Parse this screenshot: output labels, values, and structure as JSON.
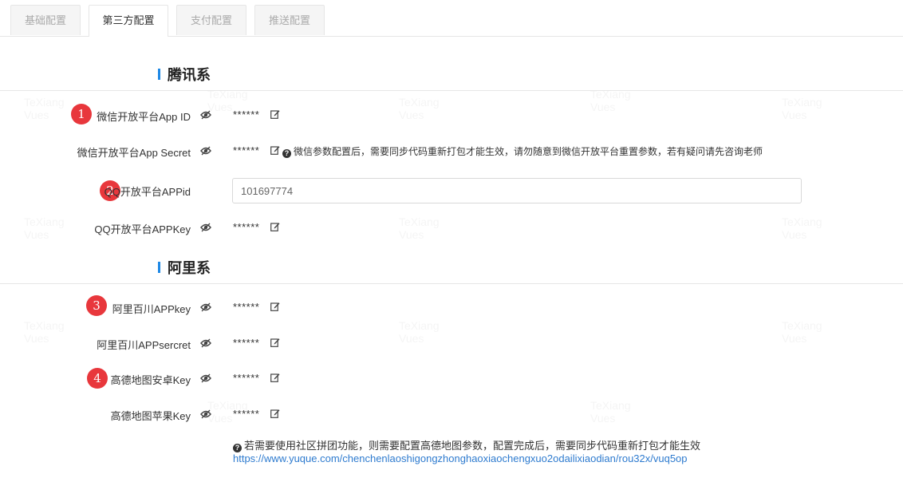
{
  "tabs": [
    {
      "label": "基础配置",
      "active": false
    },
    {
      "label": "第三方配置",
      "active": true
    },
    {
      "label": "支付配置",
      "active": false
    },
    {
      "label": "推送配置",
      "active": false
    }
  ],
  "sections": {
    "tencent": {
      "title": "腾讯系"
    },
    "ali": {
      "title": "阿里系"
    }
  },
  "fields": {
    "wechat_appid": {
      "label": "微信开放平台App ID",
      "value": "******",
      "badge": "1"
    },
    "wechat_secret": {
      "label": "微信开放平台App Secret",
      "value": "******",
      "hint": "微信参数配置后，需要同步代码重新打包才能生效，请勿随意到微信开放平台重置参数，若有疑问请先咨询老师"
    },
    "qq_appid": {
      "label": "QQ开放平台APPid",
      "value": "101697774",
      "badge": "2"
    },
    "qq_appkey": {
      "label": "QQ开放平台APPKey",
      "value": "******"
    },
    "bc_appkey": {
      "label": "阿里百川APPkey",
      "value": "******",
      "badge": "3"
    },
    "bc_secret": {
      "label": "阿里百川APPsercret",
      "value": "******"
    },
    "amap_android": {
      "label": "高德地图安卓Key",
      "value": "******",
      "badge": "4"
    },
    "amap_ios": {
      "label": "高德地图苹果Key",
      "value": "******"
    }
  },
  "footer": {
    "note": "若需要使用社区拼团功能，则需要配置高德地图参数，配置完成后，需要同步代码重新打包才能生效",
    "link": "https://www.yuque.com/chenchenlaoshigongzhonghaoxiaochengxuo2odailixiaodian/rou32x/vuq5op"
  },
  "colors": {
    "accent": "#1e88e5",
    "badge": "#e8373c",
    "link": "#2e7bcf"
  },
  "icons": {
    "eye": "eye-icon",
    "edit": "edit-icon",
    "help": "question-circle-icon"
  }
}
